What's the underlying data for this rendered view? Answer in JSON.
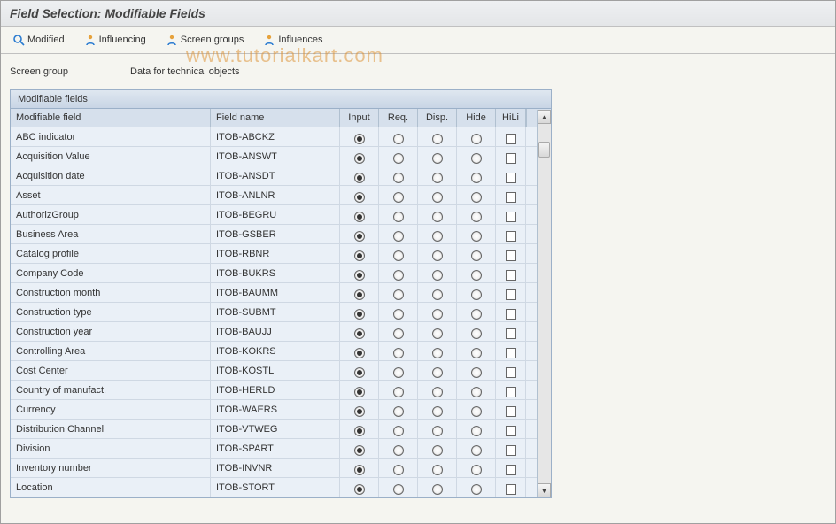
{
  "title": "Field Selection: Modifiable Fields",
  "toolbar": {
    "modified": "Modified",
    "influencing": "Influencing",
    "screen_groups": "Screen groups",
    "influences": "Influences"
  },
  "info": {
    "label": "Screen group",
    "value": "Data for technical objects"
  },
  "panel_title": "Modifiable fields",
  "columns": {
    "field": "Modifiable field",
    "name": "Field name",
    "input": "Input",
    "req": "Req.",
    "disp": "Disp.",
    "hide": "Hide",
    "hili": "HiLi"
  },
  "rows": [
    {
      "field": "ABC indicator",
      "name": "ITOB-ABCKZ",
      "sel": "input",
      "hili": false
    },
    {
      "field": "Acquisition Value",
      "name": "ITOB-ANSWT",
      "sel": "input",
      "hili": false
    },
    {
      "field": "Acquisition date",
      "name": "ITOB-ANSDT",
      "sel": "input",
      "hili": false
    },
    {
      "field": "Asset",
      "name": "ITOB-ANLNR",
      "sel": "input",
      "hili": false
    },
    {
      "field": "AuthorizGroup",
      "name": "ITOB-BEGRU",
      "sel": "input",
      "hili": false
    },
    {
      "field": "Business Area",
      "name": "ITOB-GSBER",
      "sel": "input",
      "hili": false
    },
    {
      "field": "Catalog profile",
      "name": "ITOB-RBNR",
      "sel": "input",
      "hili": false
    },
    {
      "field": "Company Code",
      "name": "ITOB-BUKRS",
      "sel": "input",
      "hili": false
    },
    {
      "field": "Construction month",
      "name": "ITOB-BAUMM",
      "sel": "input",
      "hili": false
    },
    {
      "field": "Construction type",
      "name": "ITOB-SUBMT",
      "sel": "input",
      "hili": false
    },
    {
      "field": "Construction year",
      "name": "ITOB-BAUJJ",
      "sel": "input",
      "hili": false
    },
    {
      "field": "Controlling Area",
      "name": "ITOB-KOKRS",
      "sel": "input",
      "hili": false
    },
    {
      "field": "Cost Center",
      "name": "ITOB-KOSTL",
      "sel": "input",
      "hili": false
    },
    {
      "field": "Country of manufact.",
      "name": "ITOB-HERLD",
      "sel": "input",
      "hili": false
    },
    {
      "field": "Currency",
      "name": "ITOB-WAERS",
      "sel": "input",
      "hili": false
    },
    {
      "field": "Distribution Channel",
      "name": "ITOB-VTWEG",
      "sel": "input",
      "hili": false
    },
    {
      "field": "Division",
      "name": "ITOB-SPART",
      "sel": "input",
      "hili": false
    },
    {
      "field": "Inventory number",
      "name": "ITOB-INVNR",
      "sel": "input",
      "hili": false
    },
    {
      "field": "Location",
      "name": "ITOB-STORT",
      "sel": "input",
      "hili": false
    }
  ],
  "watermark": "www.tutorialkart.com"
}
